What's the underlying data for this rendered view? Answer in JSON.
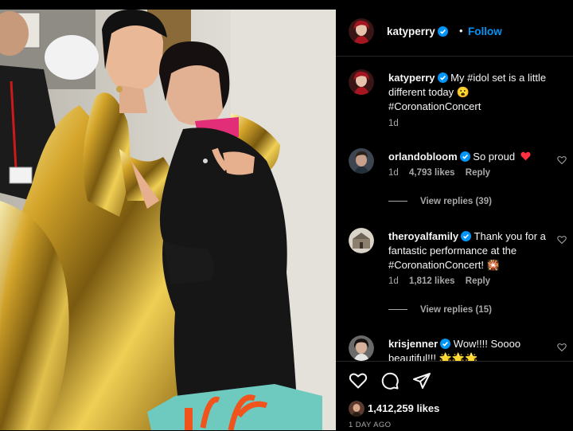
{
  "post": {
    "author": "katyperry",
    "follow_label": "Follow",
    "dot": "•",
    "caption": {
      "username": "katyperry",
      "text": "My #idol set is a little different today 😮 #CoronationConcert",
      "age": "1d"
    },
    "comments": [
      {
        "username": "orlandobloom",
        "text": "So proud",
        "age": "1d",
        "likes": "4,793 likes",
        "reply_label": "Reply",
        "view_replies": "View replies (39)"
      },
      {
        "username": "theroyalfamily",
        "text": "Thank you for a fantastic performance at the #CoronationConcert! 🎇",
        "age": "1d",
        "likes": "1,812 likes",
        "reply_label": "Reply",
        "view_replies": "View replies (15)"
      },
      {
        "username": "krisjenner",
        "text": "Wow!!!! Soooo beautiful!!! 🌟🌟🌟"
      }
    ],
    "like_count": "1,412,259 likes",
    "time_ago": "1 DAY AGO"
  },
  "colors": {
    "accent": "#0095f6",
    "background": "#000000",
    "secondary_text": "#a8a8a8",
    "heart": "#ff3040"
  },
  "icons": [
    "verified-badge-icon",
    "heart-icon",
    "comment-icon",
    "share-icon",
    "like-heart-small-icon"
  ]
}
